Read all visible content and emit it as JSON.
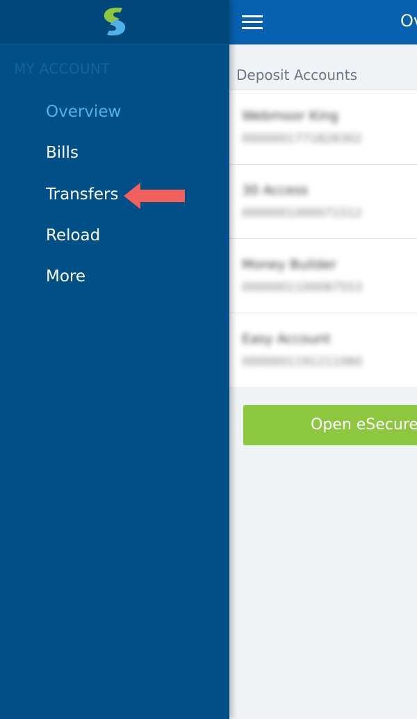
{
  "app": {
    "title_visible": "Ov"
  },
  "colors": {
    "drawer_bg": "#004f87",
    "appbar_bg": "#0861b0",
    "active_nav": "#4fb2e8",
    "button_green": "#8dc63f",
    "annotation_arrow": "#f0605d"
  },
  "drawer": {
    "logo_icon": "s-logo-icon",
    "section_label": "MY ACCOUNT",
    "items": [
      {
        "label": "Overview",
        "active": true
      },
      {
        "label": "Bills",
        "active": false
      },
      {
        "label": "Transfers",
        "active": false
      },
      {
        "label": "Reload",
        "active": false
      },
      {
        "label": "More",
        "active": false
      }
    ]
  },
  "main": {
    "menu_icon": "hamburger-menu-icon",
    "section_heading": "Deposit Accounts",
    "accounts": [
      {
        "name": "Webmoor King",
        "number": "0000001771828302"
      },
      {
        "name": "30 Access",
        "number": "0000001000071512"
      },
      {
        "name": "Money Builder",
        "number": "0000001100087553"
      },
      {
        "name": "Easy Account",
        "number": "0000001191211060"
      }
    ],
    "open_button_label": "Open eSecure S"
  },
  "annotation": {
    "icon": "left-arrow-icon"
  }
}
